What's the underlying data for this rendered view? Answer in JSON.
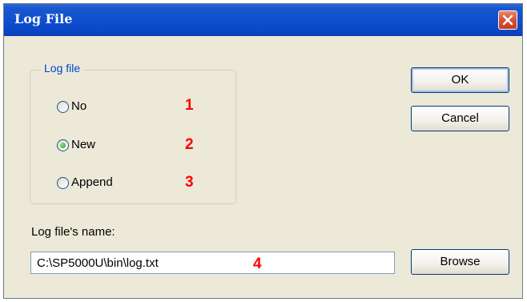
{
  "window": {
    "title": "Log File"
  },
  "log_group": {
    "legend": "Log file",
    "options": [
      {
        "label": "No",
        "selected": false,
        "callout": "1"
      },
      {
        "label": "New",
        "selected": true,
        "callout": "2"
      },
      {
        "label": "Append",
        "selected": false,
        "callout": "3"
      }
    ]
  },
  "buttons": {
    "ok": "OK",
    "cancel": "Cancel",
    "browse": "Browse"
  },
  "filename": {
    "label": "Log file's name:",
    "value": "C:\\SP5000U\\bin\\log.txt",
    "callout": "4"
  },
  "colors": {
    "titlebar": "#0a45c4",
    "callout": "#ff0000",
    "legend": "#0046d5",
    "dialog_bg": "#ece9d8"
  },
  "icons": {
    "close": "close-icon"
  }
}
